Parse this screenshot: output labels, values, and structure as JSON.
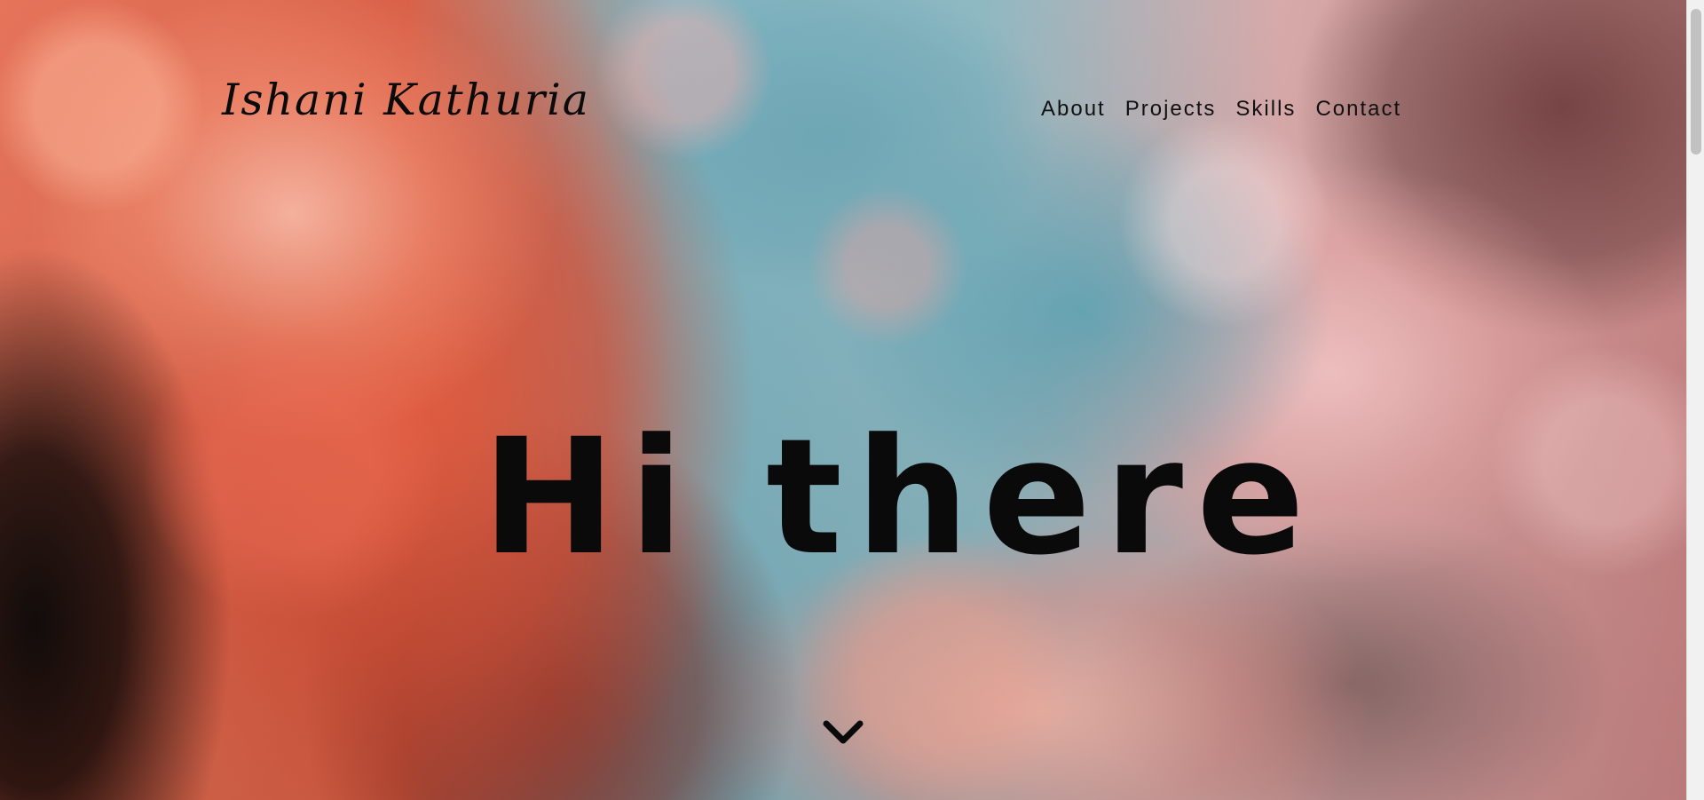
{
  "site": {
    "logo_text": "Ishani Kathuria"
  },
  "navigation": {
    "items": [
      {
        "label": "About"
      },
      {
        "label": "Projects"
      },
      {
        "label": "Skills"
      },
      {
        "label": "Contact"
      }
    ]
  },
  "hero": {
    "title": "Hi there",
    "scroll_icon": "chevron-down-icon"
  },
  "theme": {
    "text_color": "#0a0a0a",
    "sky_blue": "#7bb1be",
    "cloud_coral": "#e46e54",
    "cloud_pink": "#d6a6a6"
  }
}
